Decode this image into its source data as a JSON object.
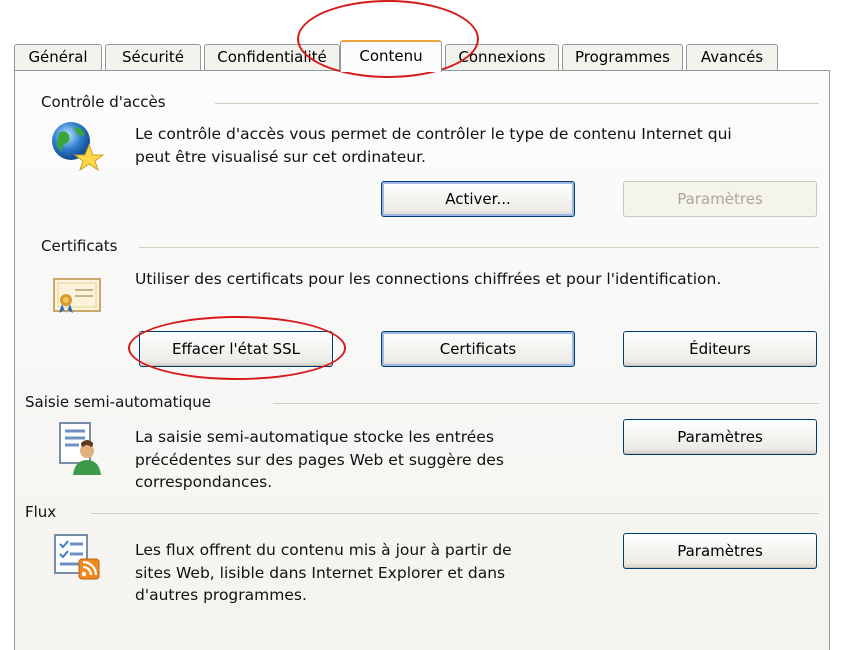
{
  "tabs": [
    {
      "label": "Général"
    },
    {
      "label": "Sécurité"
    },
    {
      "label": "Confidentialité"
    },
    {
      "label": "Contenu",
      "active": true
    },
    {
      "label": "Connexions"
    },
    {
      "label": "Programmes"
    },
    {
      "label": "Avancés"
    }
  ],
  "content_advisor": {
    "group_label": "Contrôle d'accès",
    "description_line1": "Le contrôle d'accès vous permet de contrôler le type de contenu Internet qui",
    "description_line2": "peut être visualisé sur cet ordinateur.",
    "enable_button": "Activer...",
    "settings_button": "Paramètres",
    "icon": "globe-star-icon"
  },
  "certificates": {
    "group_label": "Certificats",
    "description": "Utiliser des certificats pour les connections chiffrées et pour l'identification.",
    "clear_ssl_button": "Effacer l'état SSL",
    "certificates_button": "Certificats",
    "publishers_button": "Éditeurs",
    "icon": "certificate-icon"
  },
  "autocomplete": {
    "group_label": "Saisie semi-automatique",
    "description_line1": "La saisie semi-automatique stocke les entrées",
    "description_line2": "précédentes sur des pages Web et suggère des",
    "description_line3": "correspondances.",
    "settings_button": "Paramètres",
    "icon": "form-user-icon"
  },
  "feeds": {
    "group_label": "Flux",
    "description_line1": "Les flux offrent du contenu mis à jour à partir de",
    "description_line2": "sites Web, lisible dans Internet Explorer et dans",
    "description_line3": "d'autres programmes.",
    "settings_button": "Paramètres",
    "icon": "rss-feed-icon"
  },
  "colors": {
    "annotation": "#d71a1a",
    "button_border": "#003c74",
    "active_tab_accent": "#e8a63a"
  }
}
